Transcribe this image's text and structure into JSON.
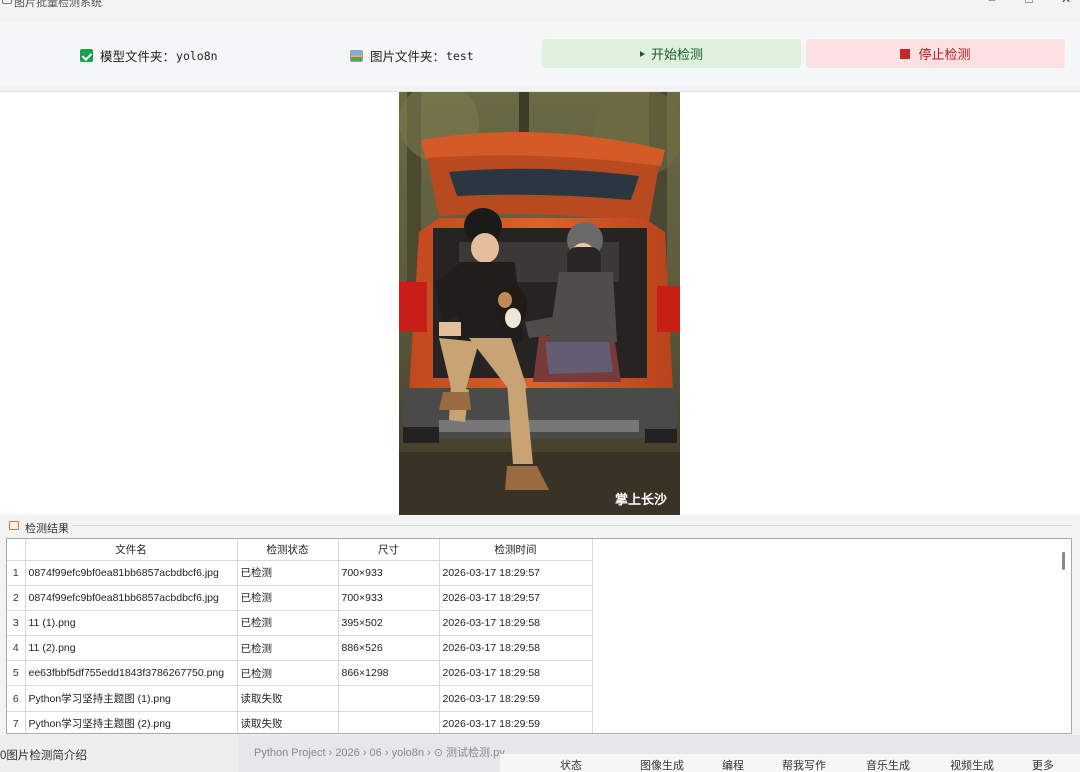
{
  "window": {
    "title": "图片批量检测系统",
    "icon": "app-icon",
    "controls": [
      "minimize-icon",
      "maximize-icon",
      "close-icon"
    ]
  },
  "toolbar": {
    "model_folder": {
      "label": "模型文件夹：",
      "value": "yolo8n",
      "icon": "check-icon"
    },
    "image_folder": {
      "label": "图片文件夹：",
      "value": "test",
      "icon": "picture-icon"
    },
    "start_label": "开始检测",
    "stop_label": "停止检测",
    "colors": {
      "start_bg": "#dff0dd",
      "start_fg": "#1b5e20",
      "stop_bg": "#fbe1e3",
      "stop_fg": "#b71c1c"
    }
  },
  "preview": {
    "watermark": "掌上长沙"
  },
  "results": {
    "title": "检测结果",
    "icon": "table-icon",
    "columns": [
      "文件名",
      "检测状态",
      "尺寸",
      "检测时间"
    ],
    "rows": [
      {
        "num": "1",
        "file": "0874f99efc9bf0ea81bb6857acbdbcf6.jpg",
        "status": "已检测",
        "size": "700×933",
        "time": "2026-03-17 18:29:57"
      },
      {
        "num": "2",
        "file": "0874f99efc9bf0ea81bb6857acbdbcf6.jpg",
        "status": "已检测",
        "size": "700×933",
        "time": "2026-03-17 18:29:57"
      },
      {
        "num": "3",
        "file": "11 (1).png",
        "status": "已检测",
        "size": "395×502",
        "time": "2026-03-17 18:29:58"
      },
      {
        "num": "4",
        "file": "11 (2).png",
        "status": "已检测",
        "size": "886×526",
        "time": "2026-03-17 18:29:58"
      },
      {
        "num": "5",
        "file": "ee63fbbf5df755edd1843f3786267750.png",
        "status": "已检测",
        "size": "866×1298",
        "time": "2026-03-17 18:29:58"
      },
      {
        "num": "6",
        "file": "Python学习坚持主题图 (1).png",
        "status": "读取失败",
        "size": "",
        "time": "2026-03-17 18:29:59"
      },
      {
        "num": "7",
        "file": "Python学习坚持主题图 (2).png",
        "status": "读取失败",
        "size": "",
        "time": "2026-03-17 18:29:59"
      }
    ]
  },
  "background": {
    "left_text": "0图片检测简介绍",
    "crumb": "Python Project  ›  2026  ›  06  ›  yolo8n  ›  ⊙ 测试检测.py",
    "tools": [
      "状态",
      "图像生成",
      "编程",
      "帮我写作",
      "音乐生成",
      "视频生成",
      "更多"
    ]
  }
}
